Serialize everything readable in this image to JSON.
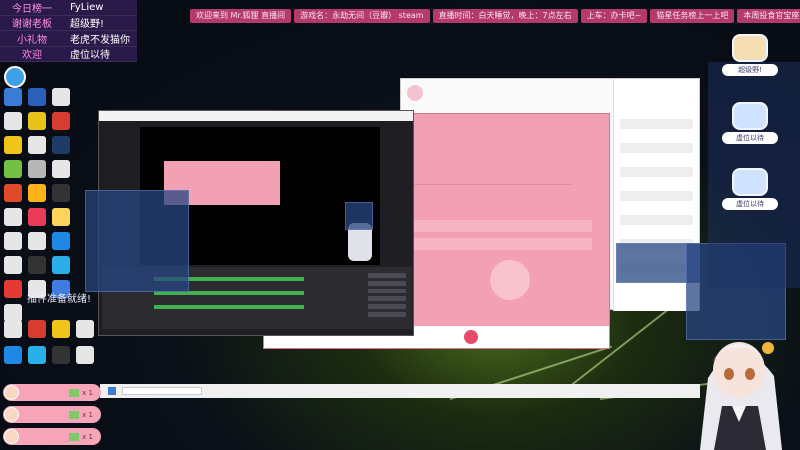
{
  "info_board": {
    "rows": [
      {
        "label": "今日榜一",
        "value": "FyLiew"
      },
      {
        "label": "谢谢老板",
        "value": "超级野!"
      },
      {
        "label": "小礼物",
        "value": "老虎不发猫你"
      },
      {
        "label": "欢迎",
        "value": "虚位以待"
      }
    ]
  },
  "ticker": {
    "items": [
      "欢迎来到 Mr.狐狸 直播间",
      "游戏名：永劫无间（豆瓣） steam",
      "直播时间：白天睡觉，晚上：7点左右",
      "上车：办卡吧~",
      "猫星任务榜上一上吧",
      "本周投食官宝座"
    ]
  },
  "notice": {
    "text": "插件准备就绪!"
  },
  "seats": [
    {
      "label": "超级野!"
    },
    {
      "label": "虚位以待"
    },
    {
      "label": "虚位以待"
    }
  ],
  "gifts": [
    {
      "count": "x 1"
    },
    {
      "count": "x 1"
    },
    {
      "count": "x 1"
    }
  ],
  "colors": {
    "accent_pink": "#f4a0b4",
    "board_bg": "#2a1a4a",
    "ticker_bg": "#b33a6b"
  }
}
